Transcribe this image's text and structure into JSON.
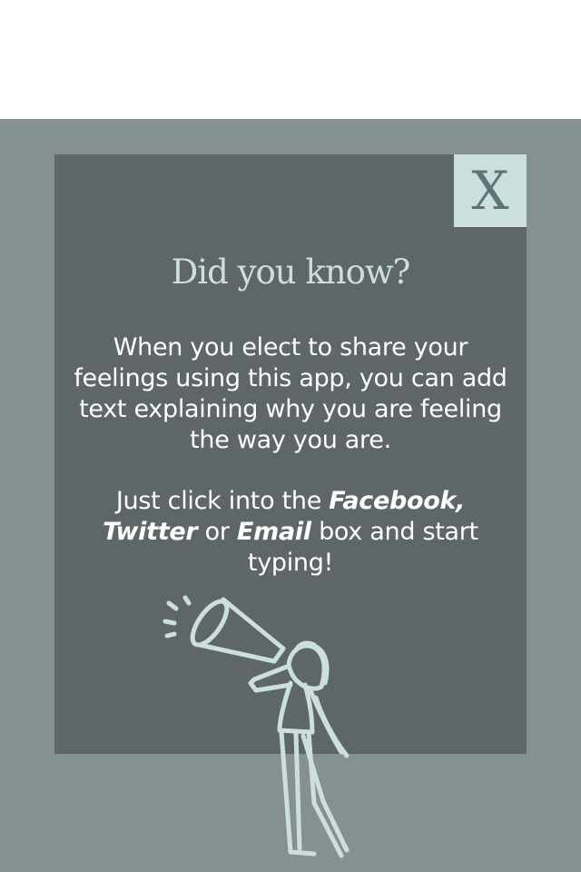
{
  "dialog": {
    "close_label": "X",
    "title": "Did you know?",
    "paragraph1": "When you elect to share your feelings using this app, you can add text explaining why you are feeling the way you are.",
    "paragraph2": {
      "prefix": "Just click into the ",
      "facebook": "Facebook,",
      "twitter": "Twitter",
      "mid": " or ",
      "email": "Email",
      "suffix": " box and start typing!"
    },
    "illustration": "person-with-megaphone-illustration"
  },
  "colors": {
    "overlay": "#859190",
    "modal": "#5f6667",
    "accent": "#cbe0de",
    "close_text": "#5c7677",
    "body_text": "#ffffff"
  }
}
